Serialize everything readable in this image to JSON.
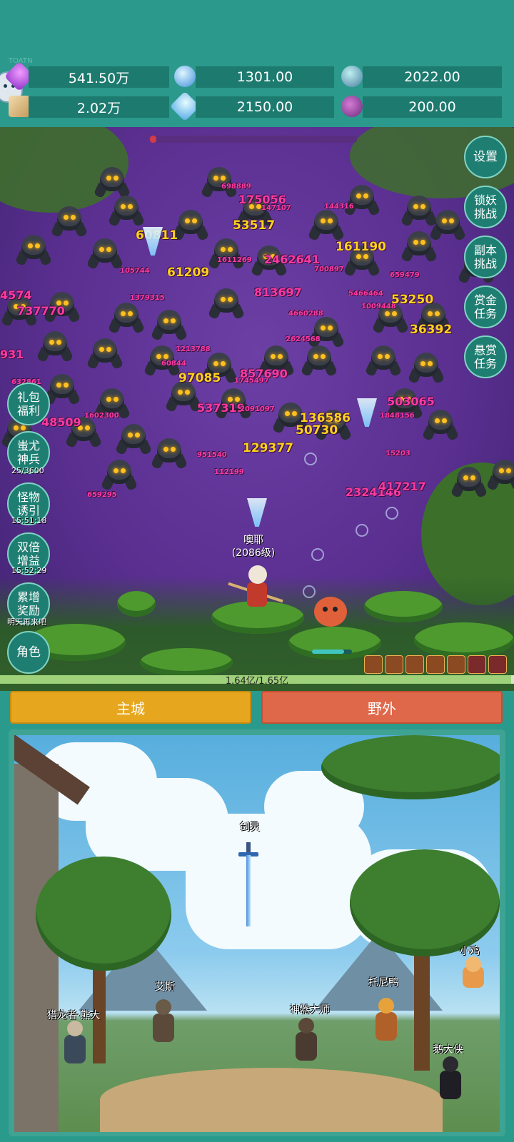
{
  "header": {
    "corner_label": "TOATN",
    "resources": [
      {
        "icon": "purple-gem-icon",
        "value": "541.50万"
      },
      {
        "icon": "blue-crystal-icon",
        "value": "1301.00"
      },
      {
        "icon": "teal-orb-icon",
        "value": "2022.00"
      },
      {
        "icon": "scroll-icon",
        "value": "2.02万"
      },
      {
        "icon": "ice-shard-icon",
        "value": "2150.00"
      },
      {
        "icon": "purple-pouch-icon",
        "value": "200.00"
      }
    ]
  },
  "battle": {
    "boss_progress": 0.03,
    "damage_numbers": [
      "698889",
      "175056",
      "147107",
      "144316",
      "53517",
      "60811",
      "2462641",
      "161190",
      "105744",
      "61209",
      "1611269",
      "700897",
      "659479",
      "4574",
      "813697",
      "5466464",
      "737770",
      "1379315",
      "1009448",
      "53250",
      "4660288",
      "36392",
      "931",
      "1213788",
      "2624568",
      "60844",
      "97085",
      "857690",
      "1745497",
      "632861",
      "503065",
      "48509",
      "537319",
      "2091097",
      "136586",
      "1602300",
      "1848156",
      "50730",
      "129377",
      "15203",
      "951540",
      "112199",
      "2324146",
      "417217",
      "659295"
    ],
    "hero_name": "噢耶",
    "hero_level": "(2086级)",
    "hp_text": "1.64亿/1.65亿",
    "hp_ratio": 0.994
  },
  "side_left": [
    {
      "label": "礼包\n福利",
      "sub": ""
    },
    {
      "label": "蚩尤\n神兵",
      "sub": "25/3600"
    },
    {
      "label": "怪物\n诱引",
      "sub": "15:51:18"
    },
    {
      "label": "双倍\n增益",
      "sub": "15:52:29"
    },
    {
      "label": "累增\n奖励",
      "sub": "明天再来吧"
    },
    {
      "label": "角色",
      "sub": ""
    }
  ],
  "side_right": [
    {
      "label": "设置"
    },
    {
      "label": "锁妖\n挑战"
    },
    {
      "label": "副本\n挑战"
    },
    {
      "label": "赏金\n任务"
    },
    {
      "label": "悬赏\n任务"
    }
  ],
  "tabs": {
    "main_city": "主城",
    "wild": "野外"
  },
  "colors": {
    "main_city": "#e6a71f",
    "wild": "#e0684a",
    "teal": "#2b998b"
  },
  "town": {
    "npcs": [
      "剑灵",
      "艾斯",
      "猎龙者·熊大",
      "神器大师",
      "托尼鸭",
      "小鸡",
      "鹅大侠"
    ]
  }
}
